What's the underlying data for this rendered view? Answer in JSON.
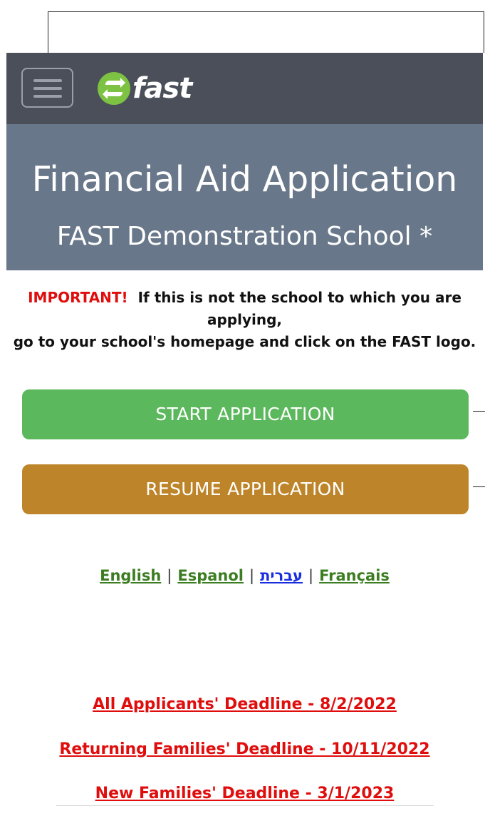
{
  "app": {
    "logo_text": "fast",
    "logo_color": "#7dc242"
  },
  "hero": {
    "title": "Financial Aid Application",
    "subtitle": "FAST Demonstration School *"
  },
  "notice": {
    "important_label": "IMPORTANT!",
    "line1": "If this is not the school to which you are",
    "line2": "applying,",
    "line3": "go to your school's homepage and click on the FAST logo."
  },
  "buttons": {
    "start_label": "START APPLICATION",
    "resume_label": "RESUME APPLICATION",
    "start_color": "#5cb85c",
    "resume_color": "#bd8429"
  },
  "languages": {
    "items": [
      "English",
      "Espanol",
      "עברית",
      "Français"
    ],
    "separator": "|"
  },
  "deadlines": [
    "All Applicants' Deadline - 8/2/2022",
    "Returning Families' Deadline - 10/11/2022",
    "New Families' Deadline - 3/1/2023"
  ],
  "icons": {
    "menu": "hamburger-menu-icon",
    "logo": "fast-logo-icon"
  }
}
